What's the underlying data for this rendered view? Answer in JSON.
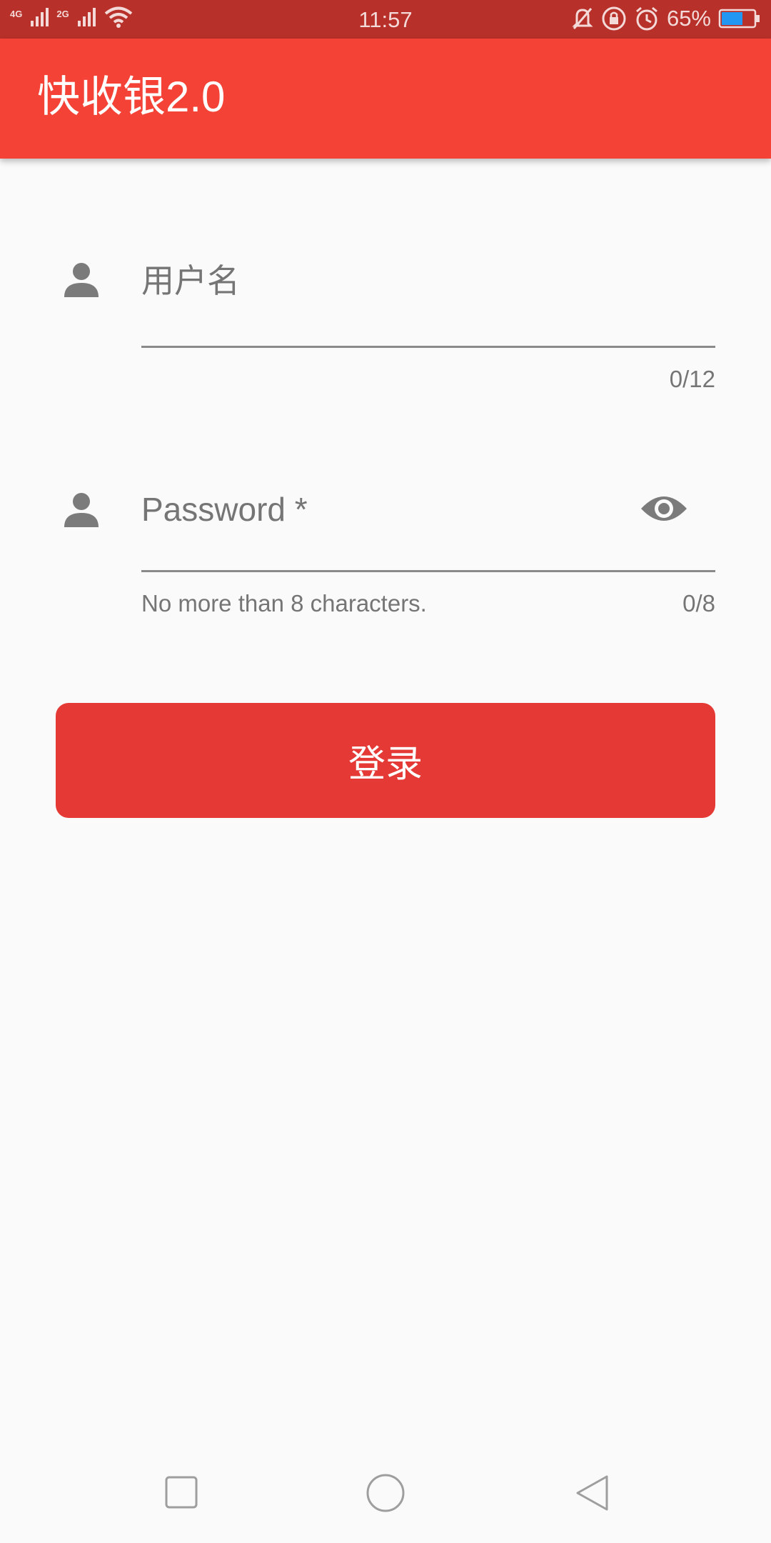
{
  "status_bar": {
    "network_1": "4G",
    "network_2": "2G",
    "time": "11:57",
    "battery_percent": "65%",
    "battery_level": 0.65,
    "icons": [
      "signal-icon",
      "wifi-icon",
      "mute-icon",
      "rotation-lock-icon",
      "alarm-icon",
      "battery-icon"
    ]
  },
  "app_bar": {
    "title": "快收银2.0",
    "color": "#f44336"
  },
  "form": {
    "username": {
      "placeholder": "用户名",
      "value": "",
      "counter": "0/12",
      "icon": "person-icon"
    },
    "password": {
      "placeholder": "Password *",
      "value": "",
      "helper": "No more than 8 characters.",
      "counter": "0/8",
      "icon": "person-icon",
      "toggle_icon": "eye-icon"
    },
    "login_button": {
      "label": "登录",
      "color": "#e53935"
    }
  },
  "nav_bar": {
    "buttons": [
      "recents-icon",
      "home-icon",
      "back-icon"
    ]
  }
}
